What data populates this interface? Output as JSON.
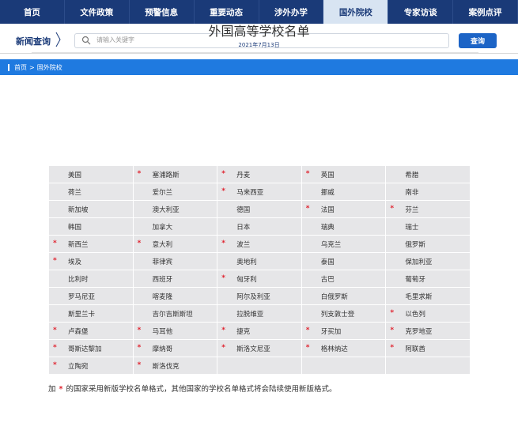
{
  "nav": [
    "首页",
    "文件政策",
    "预警信息",
    "重要动态",
    "涉外办学",
    "国外院校",
    "专家访谈",
    "案例点评"
  ],
  "nav_active": 5,
  "search": {
    "label": "新闻查询",
    "placeholder": "请输入关键字",
    "button": "查询"
  },
  "breadcrumb": {
    "home": "首页",
    "sep": ">",
    "current": "国外院校"
  },
  "article": {
    "title": "外国高等学校名单",
    "date": "2021年7月13日"
  },
  "countries": [
    [
      {
        "name": "美国",
        "star": false
      },
      {
        "name": "塞浦路斯",
        "star": true
      },
      {
        "name": "丹麦",
        "star": true
      },
      {
        "name": "英国",
        "star": true
      },
      {
        "name": "希腊",
        "star": false
      }
    ],
    [
      {
        "name": "荷兰",
        "star": false
      },
      {
        "name": "爱尔兰",
        "star": false
      },
      {
        "name": "马来西亚",
        "star": true
      },
      {
        "name": "挪威",
        "star": false
      },
      {
        "name": "南非",
        "star": false
      }
    ],
    [
      {
        "name": "新加坡",
        "star": false
      },
      {
        "name": "澳大利亚",
        "star": false
      },
      {
        "name": "德国",
        "star": false
      },
      {
        "name": "法国",
        "star": true
      },
      {
        "name": "芬兰",
        "star": true
      }
    ],
    [
      {
        "name": "韩国",
        "star": false
      },
      {
        "name": "加拿大",
        "star": false
      },
      {
        "name": "日本",
        "star": false
      },
      {
        "name": "瑞典",
        "star": false
      },
      {
        "name": "瑞士",
        "star": false
      }
    ],
    [
      {
        "name": "新西兰",
        "star": true
      },
      {
        "name": "意大利",
        "star": true
      },
      {
        "name": "波兰",
        "star": true
      },
      {
        "name": "乌克兰",
        "star": false
      },
      {
        "name": "俄罗斯",
        "star": false
      }
    ],
    [
      {
        "name": "埃及",
        "star": true
      },
      {
        "name": "菲律宾",
        "star": false
      },
      {
        "name": "奥地利",
        "star": false
      },
      {
        "name": "泰国",
        "star": false
      },
      {
        "name": "保加利亚",
        "star": false
      }
    ],
    [
      {
        "name": "比利时",
        "star": false
      },
      {
        "name": "西班牙",
        "star": false
      },
      {
        "name": "匈牙利",
        "star": true
      },
      {
        "name": "古巴",
        "star": false
      },
      {
        "name": "葡萄牙",
        "star": false
      }
    ],
    [
      {
        "name": "罗马尼亚",
        "star": false
      },
      {
        "name": "喀麦隆",
        "star": false
      },
      {
        "name": "阿尔及利亚",
        "star": false
      },
      {
        "name": "白俄罗斯",
        "star": false
      },
      {
        "name": "毛里求斯",
        "star": false
      }
    ],
    [
      {
        "name": "斯里兰卡",
        "star": false
      },
      {
        "name": "吉尔吉斯斯坦",
        "star": false
      },
      {
        "name": "拉脱维亚",
        "star": false
      },
      {
        "name": "列支敦士登",
        "star": false
      },
      {
        "name": "以色列",
        "star": true
      }
    ],
    [
      {
        "name": "卢森堡",
        "star": true
      },
      {
        "name": "马耳他",
        "star": true
      },
      {
        "name": "捷克",
        "star": true
      },
      {
        "name": "牙买加",
        "star": true
      },
      {
        "name": "克罗地亚",
        "star": true
      }
    ],
    [
      {
        "name": "哥斯达黎加",
        "star": true
      },
      {
        "name": "摩纳哥",
        "star": true
      },
      {
        "name": "斯洛文尼亚",
        "star": true
      },
      {
        "name": "格林纳达",
        "star": true
      },
      {
        "name": "阿联酋",
        "star": true
      }
    ],
    [
      {
        "name": "立陶宛",
        "star": true
      },
      {
        "name": "斯洛伐克",
        "star": true
      },
      {
        "name": "",
        "star": false
      },
      {
        "name": "",
        "star": false
      },
      {
        "name": "",
        "star": false
      }
    ]
  ],
  "note": {
    "prefix": "加",
    "star": "*",
    "text": "的国家采用新版学校名单格式，其他国家的学校名单格式将会陆续使用新版格式。"
  },
  "colors": {
    "nav_bg": "#1a3a78",
    "breadcrumb_bg": "#1f7ae0",
    "star": "#e0232f",
    "cell_bg": "#e6e6e8"
  }
}
